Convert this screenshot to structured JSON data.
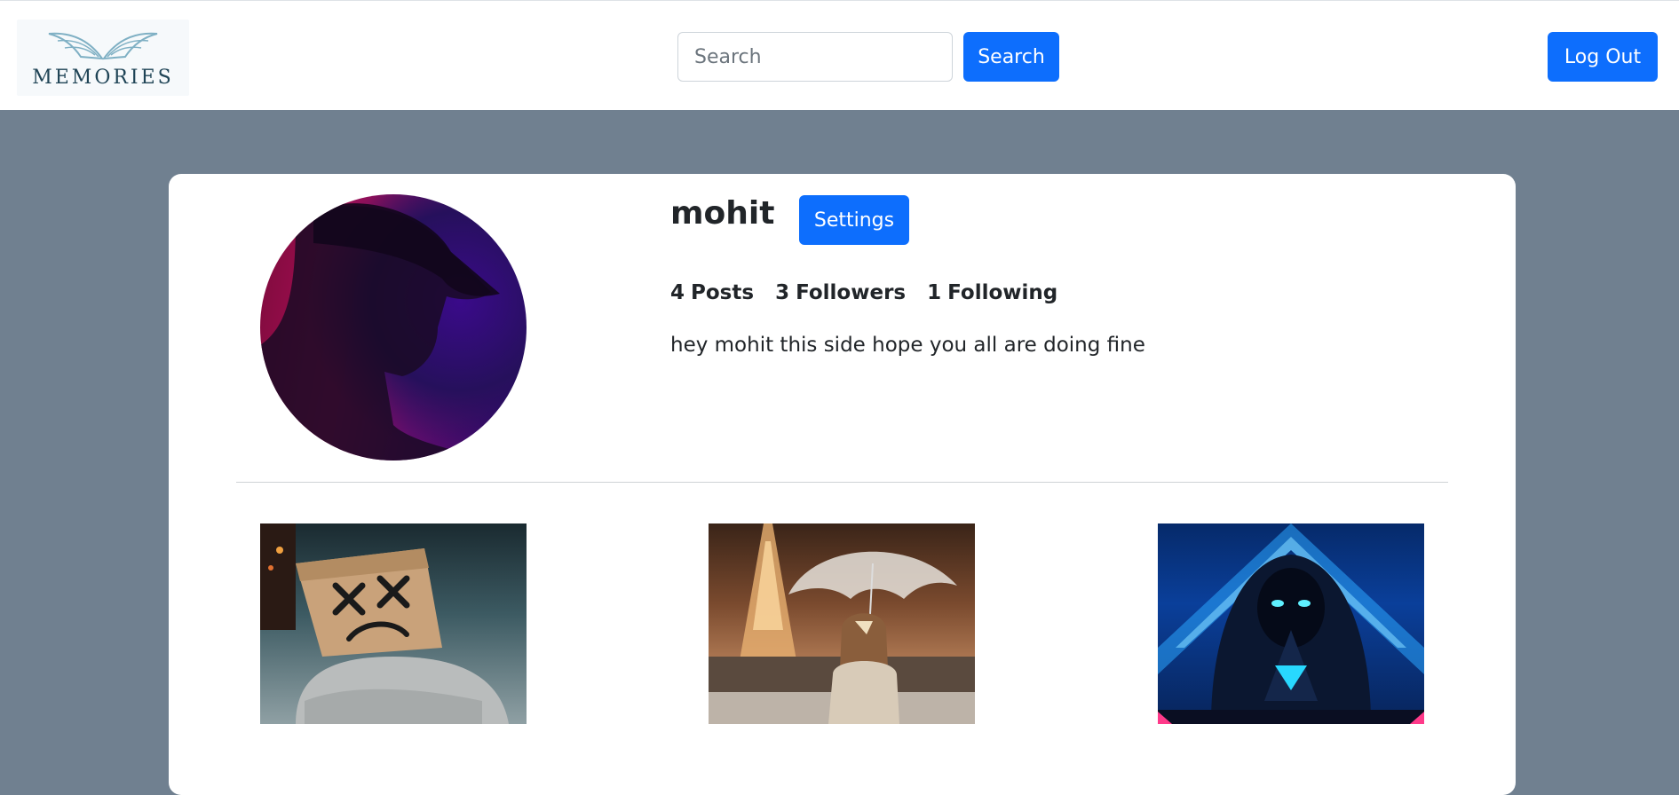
{
  "header": {
    "logo_text": "MEMORIES",
    "search": {
      "placeholder": "Search",
      "value": ""
    },
    "search_button_label": "Search",
    "logout_button_label": "Log Out"
  },
  "profile": {
    "username": "mohit",
    "settings_button_label": "Settings",
    "stats": [
      {
        "count": "4",
        "label": "Posts"
      },
      {
        "count": "3",
        "label": "Followers"
      },
      {
        "count": "1",
        "label": "Following"
      }
    ],
    "bio": "hey mohit this side hope you all are doing fine",
    "avatar": "profile-photo"
  },
  "posts": [
    {
      "image": "paper-bag-mask-person-photo"
    },
    {
      "image": "eiffel-tower-umbrella-girl-photo"
    },
    {
      "image": "hooded-figure-neon-photo"
    }
  ],
  "colors": {
    "page_background": "#708090",
    "primary": "#0d6efd",
    "card": "#ffffff"
  }
}
